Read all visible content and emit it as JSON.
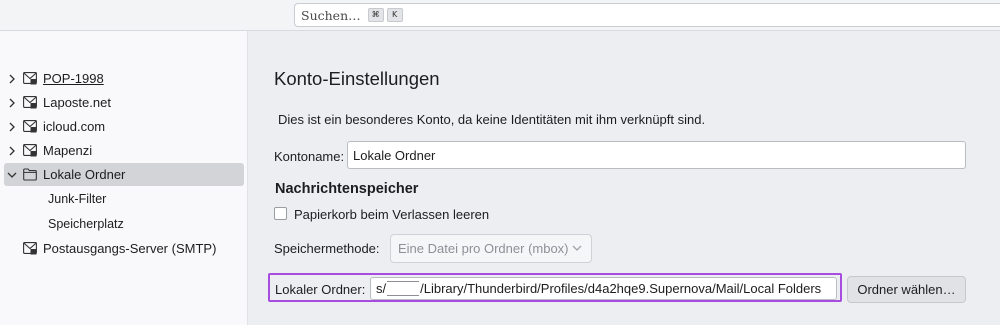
{
  "search": {
    "placeholder": "Suchen…",
    "shortcut_keys": [
      "⌘",
      "K"
    ]
  },
  "sidebar": {
    "accounts": [
      {
        "label": "POP-1998",
        "icon": "mail-account-icon",
        "expanded": false
      },
      {
        "label": "Laposte.net",
        "icon": "mail-account-icon",
        "expanded": false
      },
      {
        "label": "icloud.com",
        "icon": "mail-account-icon",
        "expanded": false
      },
      {
        "label": "Mapenzi",
        "icon": "mail-account-icon",
        "expanded": false
      },
      {
        "label": "Lokale Ordner",
        "icon": "folder-icon",
        "expanded": true,
        "selected": true
      }
    ],
    "subitems": [
      "Junk-Filter",
      "Speicherplatz"
    ],
    "smtp": {
      "label": "Postausgangs-Server (SMTP)",
      "icon": "outgoing-server-icon"
    }
  },
  "main": {
    "title": "Konto-Einstellungen",
    "description": "Dies ist ein besonderes Konto, da keine Identitäten mit ihm verknüpft sind.",
    "account_name_label": "Kontoname:",
    "account_name_value": "Lokale Ordner",
    "storage_section_title": "Nachrichtenspeicher",
    "empty_trash_label": "Papierkorb beim Verlassen leeren",
    "empty_trash_checked": false,
    "storage_method_label": "Speichermethode:",
    "storage_method_value": "Eine Datei pro Ordner (mbox)",
    "local_folder_label": "Lokaler Ordner:",
    "local_folder_prefix": "s/",
    "local_folder_suffix": "/Library/Thunderbird/Profiles/d4a2hqe9.Supernova/Mail/Local Folders",
    "choose_folder_button": "Ordner wählen…"
  },
  "colors": {
    "highlight_border": "#a64de0",
    "selected_row": "#d3d4d8",
    "content_background": "#eceef2"
  }
}
